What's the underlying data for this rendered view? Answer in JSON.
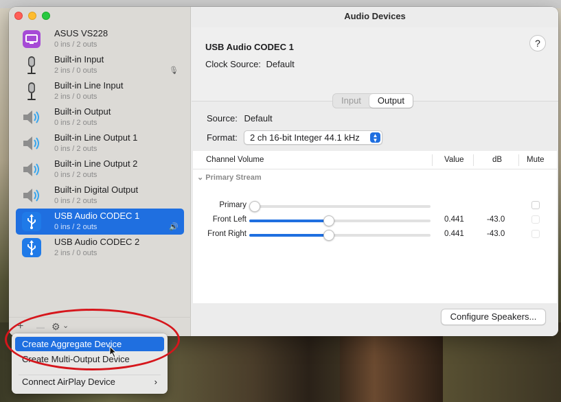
{
  "window": {
    "title": "Audio Devices"
  },
  "devices": [
    {
      "name": "ASUS VS228",
      "io": "0 ins / 2 outs",
      "icon": "display-icon",
      "right": ""
    },
    {
      "name": "Built-in Input",
      "io": "2 ins / 0 outs",
      "icon": "microphone-icon",
      "right": "🎙"
    },
    {
      "name": "Built-in Line Input",
      "io": "2 ins / 0 outs",
      "icon": "microphone-icon",
      "right": ""
    },
    {
      "name": "Built-in Output",
      "io": "0 ins / 2 outs",
      "icon": "speaker-icon",
      "right": ""
    },
    {
      "name": "Built-in Line Output 1",
      "io": "0 ins / 2 outs",
      "icon": "speaker-icon",
      "right": ""
    },
    {
      "name": "Built-in Line Output 2",
      "io": "0 ins / 2 outs",
      "icon": "speaker-icon",
      "right": ""
    },
    {
      "name": "Built-in Digital Output",
      "io": "0 ins / 2 outs",
      "icon": "speaker-icon",
      "right": ""
    },
    {
      "name": "USB Audio CODEC  1",
      "io": "0 ins / 2 outs",
      "icon": "usb-icon",
      "right": "🔊"
    },
    {
      "name": "USB Audio CODEC  2",
      "io": "2 ins / 0 outs",
      "icon": "usb-icon",
      "right": ""
    }
  ],
  "sidebar_toolbar": {
    "add": "+",
    "remove": "—",
    "gear": "⚙",
    "chevron": "⌄"
  },
  "detail": {
    "device_title": "USB Audio CODEC  1",
    "clock_label": "Clock Source:",
    "clock_value": "Default",
    "help": "?",
    "tabs": [
      "Input",
      "Output"
    ],
    "active_tab": "Output",
    "source_label": "Source:",
    "source_value": "Default",
    "format_label": "Format:",
    "format_value": "2 ch 16-bit Integer 44.1 kHz"
  },
  "table": {
    "headers": {
      "channel": "Channel Volume",
      "value": "Value",
      "db": "dB",
      "mute": "Mute"
    },
    "group": "Primary Stream",
    "group_chevron": "⌄",
    "rows": [
      {
        "name": "Primary",
        "value": "",
        "db": "",
        "level": 0.0
      },
      {
        "name": "Front Left",
        "value": "0.441",
        "db": "-43.0",
        "level": 0.441
      },
      {
        "name": "Front Right",
        "value": "0.441",
        "db": "-43.0",
        "level": 0.441
      }
    ]
  },
  "configure_button": "Configure Speakers...",
  "menu": {
    "items": [
      "Create Aggregate Device",
      "Create Multi-Output Device",
      "Connect AirPlay Device"
    ],
    "submenu_chevron": "›"
  },
  "colors": {
    "accent": "#1f6fe0",
    "annotation": "#d6161c"
  }
}
